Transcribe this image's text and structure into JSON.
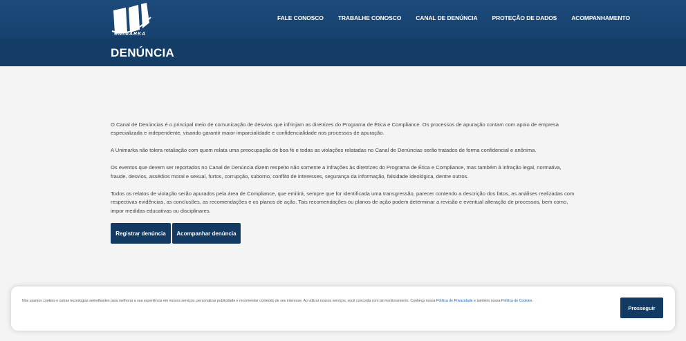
{
  "brand": {
    "name": "UNIMARKA"
  },
  "nav": [
    {
      "label": "FALE CONOSCO"
    },
    {
      "label": "TRABALHE CONOSCO"
    },
    {
      "label": "CANAL DE DENÚNCIA"
    },
    {
      "label": "PROTEÇÃO DE DADOS"
    },
    {
      "label": "ACOMPANHAMENTO"
    }
  ],
  "page": {
    "title": "DENÚNCIA"
  },
  "content": {
    "paragraphs": [
      "O Canal de Denúncias é o principal meio de comunicação de desvios que infrinjam as diretrizes do Programa de Ética e Compliance. Os processos de apuração contam com apoio de empresa especializada e independente, visando garantir maior imparcialidade e confidencialidade nos processos de apuração.",
      "A Unimarka não tolera retaliação com quem relata uma preocupação de boa fé e todas as violações relatadas no Canal de Denúncias serão tratados de forma confidencial e anônima.",
      "Os eventos que devem ser reportados no Canal de Denúncia dizem respeito não somente a infrações às diretrizes do Programa de Ética e Compliance, mas também à infração legal, normativa, fraude, desvios, assédios moral e sexual, furtos, corrupção, suborno, conflito de interesses, segurança da informação, falsidade ideológica, dentre outros.",
      "Todos os relatos de violação serão apurados pela área de Compliance, que emitirá, sempre que for identificada uma transgressão, parecer contendo a descrição dos fatos, as análises realizadas com respectivas evidências, as conclusões, as recomendações e os planos de ação. Tais recomendações ou planos de ação podem determinar a revisão e eventual alteração de processos, bem como, impor medidas educativas ou disciplinares."
    ]
  },
  "actions": {
    "register": "Registrar denúncia",
    "follow": "Acompanhar denúncia"
  },
  "cookie": {
    "text": "Nós usamos cookies e outras tecnologias semelhantes para melhorar a sua experiência em nossos serviços, personalizar publicidade e recomendar conteúdo de seu interesse. Ao utilizar nossos serviços, você concorda com tal monitoramento. Conheça nossa ",
    "privacy_link": "Política de Privacidade",
    "middle": " e também nossa ",
    "cookies_link": "Política de Cookies",
    "end": ".",
    "button": "Prosseguir"
  },
  "colors": {
    "primary": "#123a63",
    "header": "#1c4a7a",
    "link": "#1d5fa8"
  }
}
